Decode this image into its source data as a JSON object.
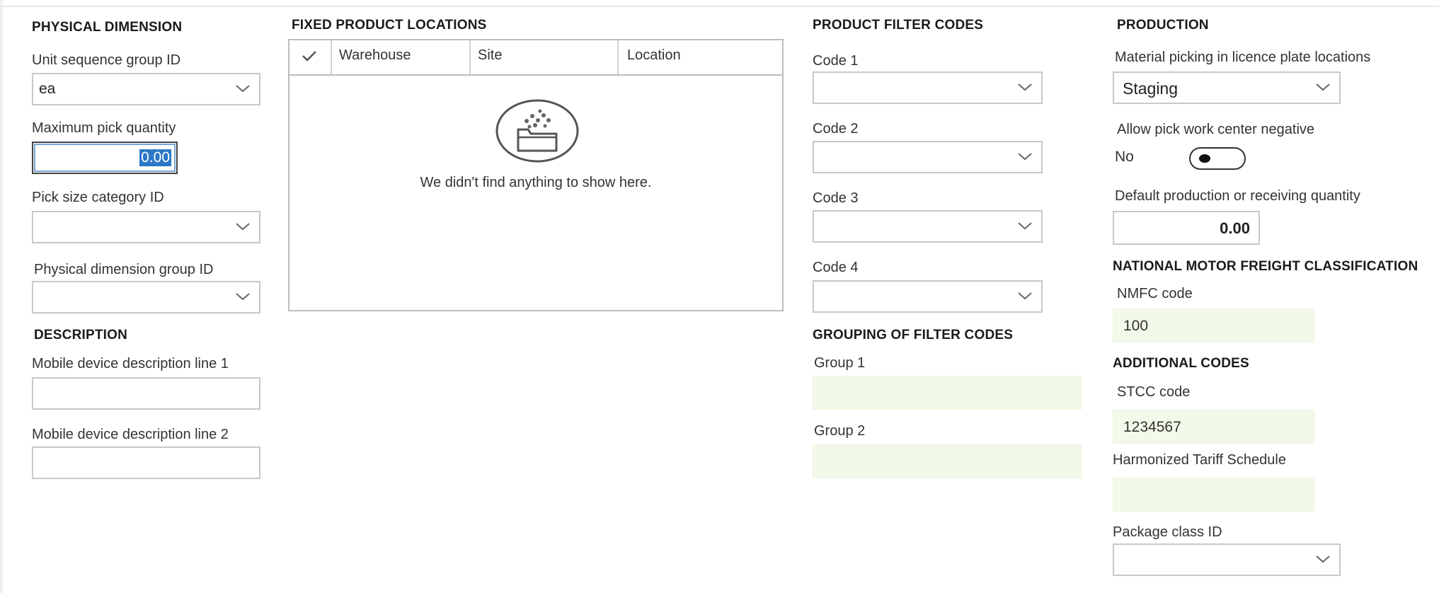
{
  "physical_dimension": {
    "heading": "PHYSICAL DIMENSION",
    "unit_sequence_group_id": {
      "label": "Unit sequence group ID",
      "value": "ea"
    },
    "maximum_pick_quantity": {
      "label": "Maximum pick quantity",
      "value": "0.00"
    },
    "pick_size_category_id": {
      "label": "Pick size category ID",
      "value": ""
    },
    "physical_dimension_group_id": {
      "label": "Physical dimension group ID",
      "value": ""
    }
  },
  "description": {
    "heading": "DESCRIPTION",
    "line1": {
      "label": "Mobile device description line 1",
      "value": ""
    },
    "line2": {
      "label": "Mobile device description line 2",
      "value": ""
    }
  },
  "fixed_product_locations": {
    "heading": "FIXED PRODUCT LOCATIONS",
    "columns": [
      "Warehouse",
      "Site",
      "Location"
    ],
    "empty_message": "We didn't find anything to show here."
  },
  "product_filter_codes": {
    "heading": "PRODUCT FILTER CODES",
    "codes": [
      {
        "label": "Code 1",
        "value": ""
      },
      {
        "label": "Code 2",
        "value": ""
      },
      {
        "label": "Code 3",
        "value": ""
      },
      {
        "label": "Code 4",
        "value": ""
      }
    ]
  },
  "grouping_of_filter_codes": {
    "heading": "GROUPING OF FILTER CODES",
    "groups": [
      {
        "label": "Group 1",
        "value": ""
      },
      {
        "label": "Group 2",
        "value": ""
      }
    ]
  },
  "production": {
    "heading": "PRODUCTION",
    "material_picking": {
      "label": "Material picking in licence plate locations",
      "value": "Staging"
    },
    "allow_negative": {
      "label": "Allow pick work center negative",
      "value": "No"
    },
    "default_quantity": {
      "label": "Default production or receiving quantity",
      "value": "0.00"
    }
  },
  "nmfc": {
    "heading": "NATIONAL MOTOR FREIGHT CLASSIFICATION",
    "code": {
      "label": "NMFC code",
      "value": "100"
    }
  },
  "additional_codes": {
    "heading": "ADDITIONAL CODES",
    "stcc": {
      "label": "STCC code",
      "value": "1234567"
    },
    "hts": {
      "label": "Harmonized Tariff Schedule",
      "value": ""
    },
    "package_class": {
      "label": "Package class ID",
      "value": ""
    }
  },
  "icons": {
    "dropdown": "chevron-down-icon",
    "select_all": "checkmark-icon",
    "empty_state": "empty-folder-icon"
  },
  "colors": {
    "readonly_field_bg": "#f3f9e8",
    "selection_highlight": "#2b78c6",
    "field_border": "#c8c8c8"
  }
}
